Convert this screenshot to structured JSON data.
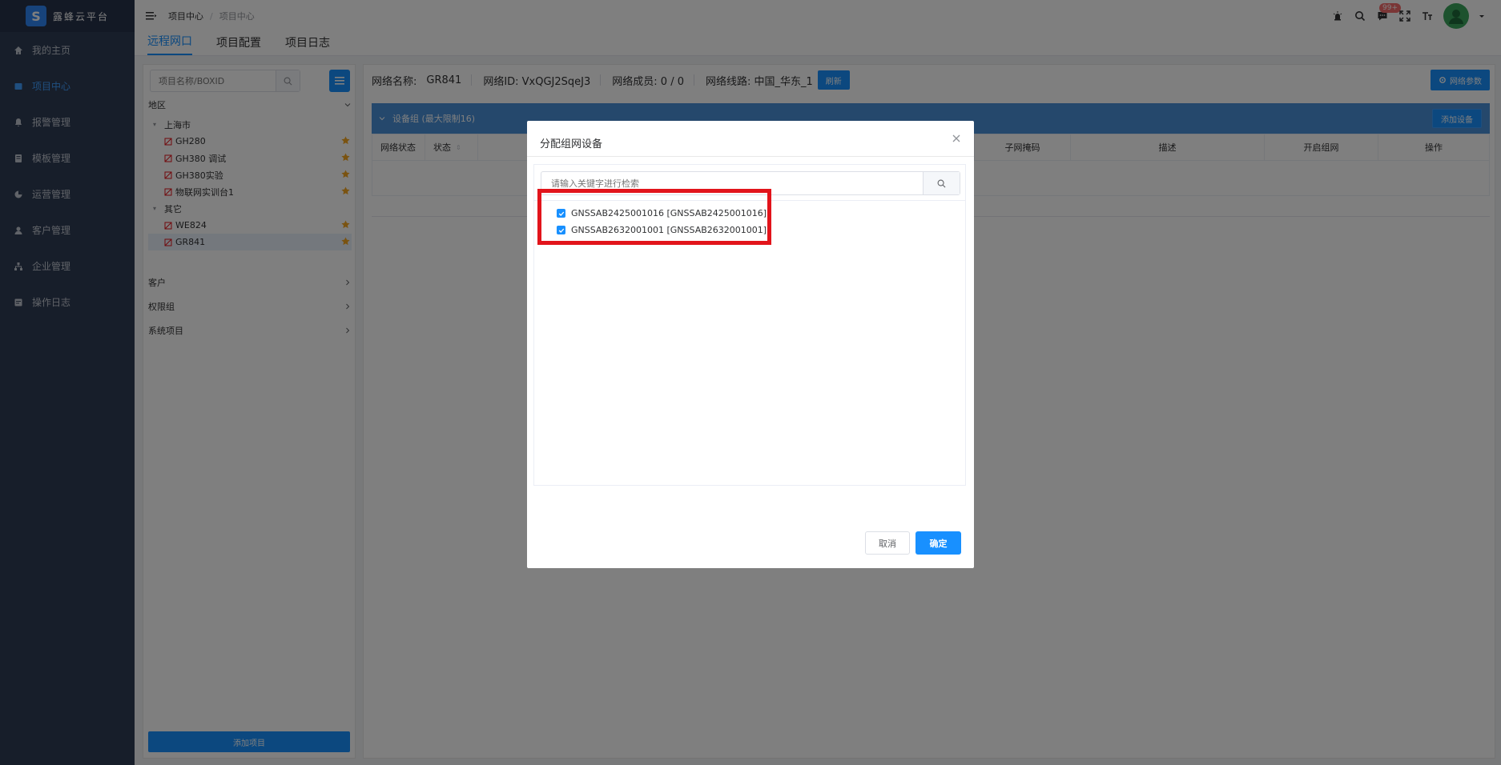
{
  "brand": {
    "logo": "S",
    "title": "露蜂云平台"
  },
  "nav": {
    "items": [
      {
        "label": "我的主页",
        "icon": "home-icon"
      },
      {
        "label": "项目中心",
        "icon": "project-icon",
        "active": true
      },
      {
        "label": "报警管理",
        "icon": "bell-icon"
      },
      {
        "label": "模板管理",
        "icon": "template-icon"
      },
      {
        "label": "运营管理",
        "icon": "pie-icon"
      },
      {
        "label": "客户管理",
        "icon": "user-icon"
      },
      {
        "label": "企业管理",
        "icon": "org-icon"
      },
      {
        "label": "操作日志",
        "icon": "log-icon"
      }
    ]
  },
  "topbar": {
    "breadcrumb": [
      "项目中心",
      "项目中心"
    ],
    "badge": "99+"
  },
  "tabs": [
    "远程网口",
    "项目配置",
    "项目日志"
  ],
  "left_panel": {
    "search_placeholder": "项目名称/BOXID",
    "region_label": "地区",
    "tree": [
      {
        "label": "上海市",
        "type": "group"
      },
      {
        "label": "GH280",
        "type": "device"
      },
      {
        "label": "GH380 调试",
        "type": "device"
      },
      {
        "label": "GH380实验",
        "type": "device"
      },
      {
        "label": "物联网实训台1",
        "type": "device"
      },
      {
        "label": "其它",
        "type": "group"
      },
      {
        "label": "WE824",
        "type": "device"
      },
      {
        "label": "GR841",
        "type": "device",
        "selected": true
      }
    ],
    "sections": [
      "客户",
      "权限组",
      "系统项目"
    ],
    "add_project": "添加项目"
  },
  "main": {
    "network_name_label": "网络名称:",
    "network_name": "GR841",
    "network_id": "网络ID: VxQGJ2SqeJ3",
    "members": "网络成员: 0 / 0",
    "line": "网络线路: 中国_华东_1",
    "refresh": "刷新",
    "network_params": "网络参数",
    "device_group": "设备组 (最大限制16)",
    "add_device": "添加设备",
    "columns": [
      "网络状态",
      "状态",
      "子网掩码",
      "描述",
      "开启组网",
      "操作"
    ]
  },
  "dialog": {
    "title": "分配组网设备",
    "search_placeholder": "请输入关键字进行检索",
    "items": [
      {
        "label": "GNSSAB2425001016 [GNSSAB2425001016]",
        "checked": true
      },
      {
        "label": "GNSSAB2632001001 [GNSSAB2632001001]",
        "checked": true
      }
    ],
    "cancel": "取消",
    "confirm": "确定"
  },
  "colors": {
    "primary": "#1890ff",
    "nav_bg": "#2f3d54",
    "highlight": "#e2141b",
    "star": "#f5a623"
  }
}
